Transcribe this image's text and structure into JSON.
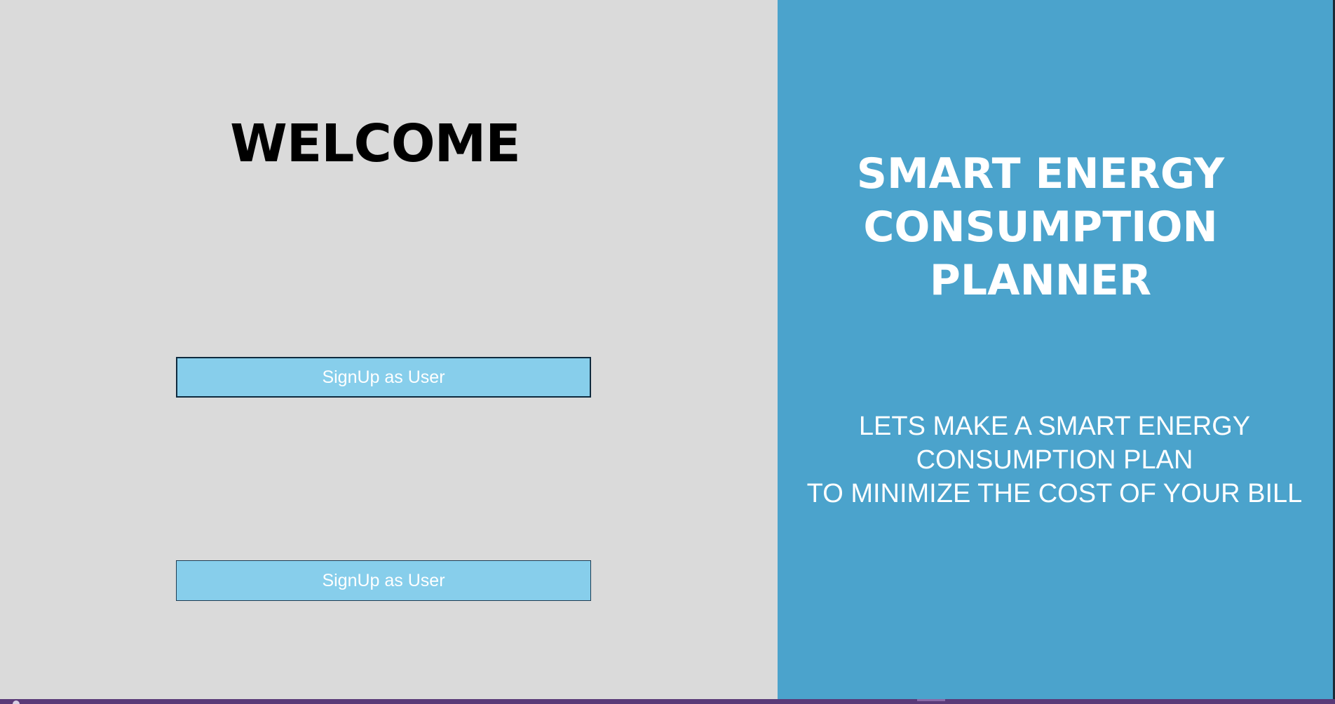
{
  "left": {
    "welcome": "WELCOME",
    "buttons": [
      {
        "label": "SignUp as User"
      },
      {
        "label": "SignUp as User"
      }
    ]
  },
  "right": {
    "title_lines": [
      "SMART ENERGY",
      "CONSUMPTION",
      "PLANNER"
    ],
    "tagline_lines": [
      "LETS MAKE A SMART ENERGY",
      "CONSUMPTION PLAN",
      "TO MINIMIZE THE COST OF YOUR BILL"
    ]
  },
  "colors": {
    "left_background": "#dadada",
    "right_background": "#4ba3cc",
    "button_background": "#87ceeb",
    "taskbar": "#5a3a78"
  },
  "icons": {
    "taskbar_corner": "app-icon"
  }
}
